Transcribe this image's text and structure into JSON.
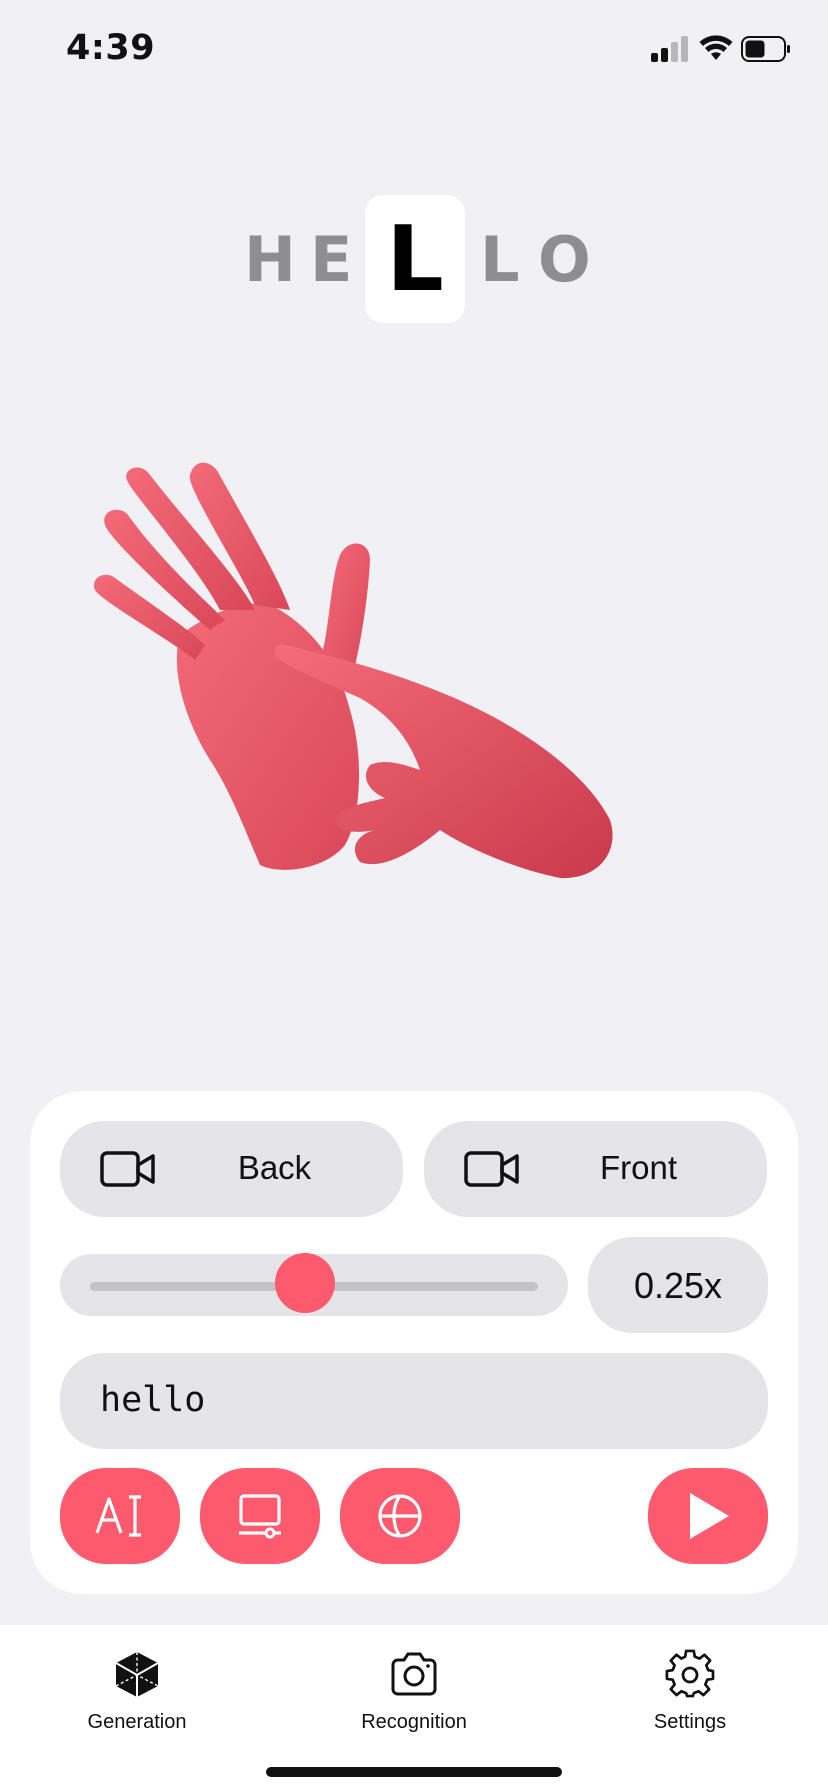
{
  "status_bar": {
    "time": "4:39",
    "signal_bars": 2,
    "battery_level": 0.5
  },
  "word_display": {
    "letters": [
      "H",
      "E",
      "L",
      "L",
      "O"
    ],
    "active_index": 2,
    "active_letter": "L"
  },
  "avatar_view": {
    "icon": "3d-hands-illustration",
    "hand_color": "#f15a6a"
  },
  "controls": {
    "back_camera_label": "Back",
    "front_camera_label": "Front",
    "speed_value": "0.25x",
    "speed_slider_level": 0.48,
    "text_input_value": "hello",
    "action_icons": [
      "text-recognition-icon",
      "monitor-icon",
      "globe-icon"
    ],
    "play_icon": "play-icon",
    "accent_color": "#fe5a6d"
  },
  "tabbar": {
    "items": [
      {
        "label": "Generation",
        "icon": "cube-icon"
      },
      {
        "label": "Recognition",
        "icon": "camera-icon"
      },
      {
        "label": "Settings",
        "icon": "gear-icon"
      }
    ]
  }
}
